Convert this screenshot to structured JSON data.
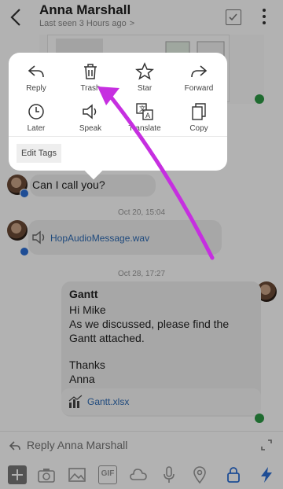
{
  "header": {
    "title": "Anna Marshall",
    "subtitle": "Last seen 3 Hours ago",
    "subtitle_chevron": ">"
  },
  "popover": {
    "actions": [
      {
        "label": "Reply",
        "icon": "reply-icon"
      },
      {
        "label": "Trash",
        "icon": "trash-icon"
      },
      {
        "label": "Star",
        "icon": "star-icon"
      },
      {
        "label": "Forward",
        "icon": "forward-icon"
      },
      {
        "label": "Later",
        "icon": "clock-icon"
      },
      {
        "label": "Speak",
        "icon": "speaker-icon"
      },
      {
        "label": "Translate",
        "icon": "translate-icon"
      },
      {
        "label": "Copy",
        "icon": "copy-icon"
      }
    ],
    "edit_tags": "Edit Tags"
  },
  "messages": {
    "call_text": "Can I call you?",
    "date1": "Oct 20, 15:04",
    "audio_file": "HopAudioMessage.wav",
    "date2": "Oct 28, 17:27",
    "gantt": {
      "subject": "Gantt",
      "line1": "Hi Mike",
      "line2": "As we discussed, please find the",
      "line3": "Gantt attached.",
      "line4": "Thanks",
      "line5": "Anna",
      "attachment": "Gantt.xlsx"
    }
  },
  "compose": {
    "placeholder": "Reply Anna Marshall"
  },
  "toolbar": {
    "gif_label": "GIF"
  },
  "colors": {
    "accent_blue": "#2d6ab4",
    "arrow_magenta": "#c62fe0",
    "preview_eye_green": "#2d9a46"
  }
}
